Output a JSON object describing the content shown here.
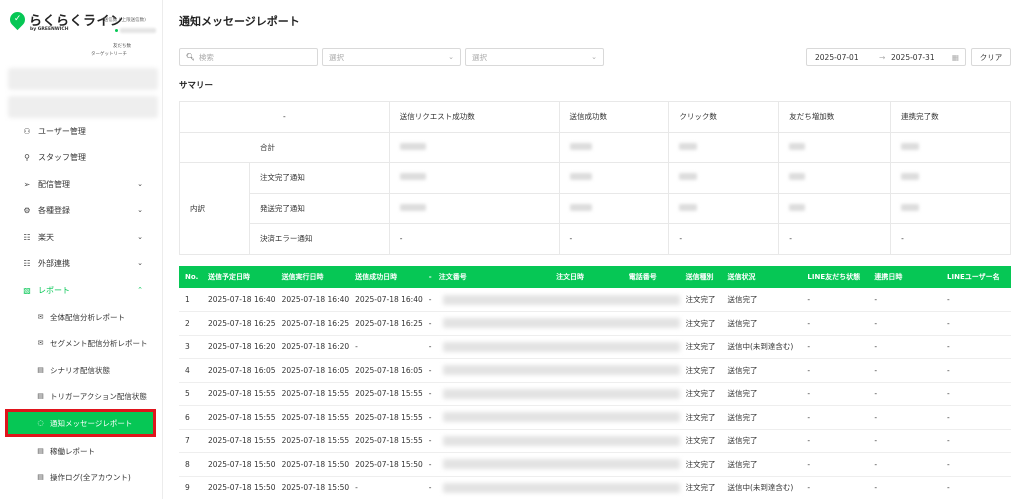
{
  "brand": {
    "name": "らくらくライン",
    "mark": "✓",
    "sub": "by GREENWICH",
    "send_count_label": "(送信数 / 上限送信数)",
    "friends_label": "友だち数",
    "target_reach_label": "ターゲットリーチ"
  },
  "sidebar": {
    "items": [
      {
        "label": "ユーザー管理",
        "icon": "users-icon",
        "glyph": "⚇"
      },
      {
        "label": "スタッフ管理",
        "icon": "person-icon",
        "glyph": "⚲"
      },
      {
        "label": "配信管理",
        "icon": "send-icon",
        "glyph": "➢",
        "chevron": "⌄"
      },
      {
        "label": "各種登録",
        "icon": "gear-icon",
        "glyph": "⚙",
        "chevron": "⌄"
      },
      {
        "label": "楽天",
        "icon": "list-icon",
        "glyph": "☷",
        "chevron": "⌄"
      },
      {
        "label": "外部連携",
        "icon": "link-icon",
        "glyph": "☷",
        "chevron": "⌄"
      },
      {
        "label": "レポート",
        "icon": "report-icon",
        "glyph": "▧",
        "chevron": "⌃"
      }
    ],
    "sub_items": [
      {
        "label": "全体配信分析レポート",
        "icon": "mail-icon",
        "glyph": "✉"
      },
      {
        "label": "セグメント配信分析レポート",
        "icon": "mail-icon",
        "glyph": "✉"
      },
      {
        "label": "シナリオ配信状態",
        "icon": "document-icon",
        "glyph": "▤"
      },
      {
        "label": "トリガーアクション配信状態",
        "icon": "document-icon",
        "glyph": "▤"
      },
      {
        "label": "通知メッセージレポート",
        "icon": "chat-icon",
        "glyph": "◌"
      },
      {
        "label": "稼働レポート",
        "icon": "document-icon",
        "glyph": "▤"
      },
      {
        "label": "操作ログ(全アカウント)",
        "icon": "document-icon",
        "glyph": "▤"
      }
    ]
  },
  "page": {
    "title": "通知メッセージレポート",
    "search_placeholder": "検索",
    "select1_placeholder": "選択",
    "select2_placeholder": "選択",
    "date_from": "2025-07-01",
    "date_to": "2025-07-31",
    "date_arrow": "→",
    "clear_label": "クリア",
    "summary_title": "サマリー"
  },
  "summary": {
    "headers": [
      "-",
      "送信リクエスト成功数",
      "送信成功数",
      "クリック数",
      "友だち増加数",
      "連携完了数"
    ],
    "total_label": "合計",
    "group_label": "内訳",
    "rows": [
      "注文完了通知",
      "発送完了通知",
      "決済エラー通知"
    ],
    "dash": "-"
  },
  "table": {
    "headers": [
      "No.",
      "送信予定日時",
      "送信実行日時",
      "送信成功日時",
      "-",
      "注文番号",
      "注文日時",
      "電話番号",
      "送信種別",
      "送信状況",
      "LINE友だち状態",
      "連携日時",
      "LINEユーザー名"
    ],
    "rows": [
      {
        "no": "1",
        "scheduled": "2025-07-18 16:40",
        "executed": "2025-07-18 16:40",
        "succeeded": "2025-07-18 16:40",
        "dash": "-",
        "type": "注文完了",
        "status": "送信完了",
        "friend": "-",
        "linked": "-",
        "username": "-"
      },
      {
        "no": "2",
        "scheduled": "2025-07-18 16:25",
        "executed": "2025-07-18 16:25",
        "succeeded": "2025-07-18 16:25",
        "dash": "-",
        "type": "注文完了",
        "status": "送信完了",
        "friend": "-",
        "linked": "-",
        "username": "-"
      },
      {
        "no": "3",
        "scheduled": "2025-07-18 16:20",
        "executed": "2025-07-18 16:20",
        "succeeded": "-",
        "dash": "-",
        "type": "注文完了",
        "status": "送信中(未到達含む)",
        "friend": "-",
        "linked": "-",
        "username": "-"
      },
      {
        "no": "4",
        "scheduled": "2025-07-18 16:05",
        "executed": "2025-07-18 16:05",
        "succeeded": "2025-07-18 16:05",
        "dash": "-",
        "type": "注文完了",
        "status": "送信完了",
        "friend": "-",
        "linked": "-",
        "username": "-"
      },
      {
        "no": "5",
        "scheduled": "2025-07-18 15:55",
        "executed": "2025-07-18 15:55",
        "succeeded": "2025-07-18 15:55",
        "dash": "-",
        "type": "注文完了",
        "status": "送信完了",
        "friend": "-",
        "linked": "-",
        "username": "-"
      },
      {
        "no": "6",
        "scheduled": "2025-07-18 15:55",
        "executed": "2025-07-18 15:55",
        "succeeded": "2025-07-18 15:55",
        "dash": "-",
        "type": "注文完了",
        "status": "送信完了",
        "friend": "-",
        "linked": "-",
        "username": "-"
      },
      {
        "no": "7",
        "scheduled": "2025-07-18 15:55",
        "executed": "2025-07-18 15:55",
        "succeeded": "2025-07-18 15:55",
        "dash": "-",
        "type": "注文完了",
        "status": "送信完了",
        "friend": "-",
        "linked": "-",
        "username": "-"
      },
      {
        "no": "8",
        "scheduled": "2025-07-18 15:50",
        "executed": "2025-07-18 15:50",
        "succeeded": "2025-07-18 15:50",
        "dash": "-",
        "type": "注文完了",
        "status": "送信完了",
        "friend": "-",
        "linked": "-",
        "username": "-"
      },
      {
        "no": "9",
        "scheduled": "2025-07-18 15:50",
        "executed": "2025-07-18 15:50",
        "succeeded": "-",
        "dash": "-",
        "type": "注文完了",
        "status": "送信中(未到達含む)",
        "friend": "-",
        "linked": "-",
        "username": "-"
      }
    ]
  },
  "colors": {
    "accent": "#06c755",
    "highlight": "#e0141c"
  }
}
